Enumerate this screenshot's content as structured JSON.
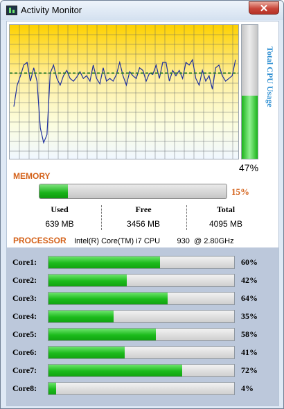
{
  "window": {
    "title": "Activity Monitor",
    "close_glyph": "✕"
  },
  "cpu": {
    "total_label": "Total CPU Usage",
    "total_percent_text": "47%",
    "total_percent": 47,
    "history": [
      39,
      55,
      62,
      70,
      72,
      58,
      68,
      58,
      23,
      12,
      18,
      64,
      70,
      60,
      55,
      62,
      66,
      60,
      58,
      61,
      65,
      60,
      62,
      58,
      70,
      60,
      56,
      68,
      58,
      60,
      58,
      63,
      72,
      62,
      55,
      65,
      62,
      60,
      68,
      66,
      58,
      64,
      63,
      70,
      60,
      72,
      72,
      58,
      66,
      62,
      66,
      60,
      72,
      70,
      74,
      60,
      55,
      66,
      58,
      62,
      52,
      68,
      70,
      62,
      58,
      60,
      62,
      74
    ],
    "average": 64
  },
  "memory": {
    "title": "MEMORY",
    "percent_text": "15%",
    "percent": 15,
    "used_label": "Used",
    "used_value": "639 MB",
    "free_label": "Free",
    "free_value": "3456 MB",
    "total_label": "Total",
    "total_value": "4095 MB"
  },
  "processor": {
    "title": "PROCESSOR",
    "name": "Intel(R) Core(TM) i7 CPU        930  @ 2.80GHz"
  },
  "cores": [
    {
      "label": "Core1:",
      "percent": 60,
      "percent_text": "60%"
    },
    {
      "label": "Core2:",
      "percent": 42,
      "percent_text": "42%"
    },
    {
      "label": "Core3:",
      "percent": 64,
      "percent_text": "64%"
    },
    {
      "label": "Core4:",
      "percent": 35,
      "percent_text": "35%"
    },
    {
      "label": "Core5:",
      "percent": 58,
      "percent_text": "58%"
    },
    {
      "label": "Core6:",
      "percent": 41,
      "percent_text": "41%"
    },
    {
      "label": "Core7:",
      "percent": 72,
      "percent_text": "72%"
    },
    {
      "label": "Core8:",
      "percent": 4,
      "percent_text": "4%"
    }
  ],
  "colors": {
    "accent_orange": "#d4621a",
    "cpu_label_blue": "#2f8fd2",
    "bar_green": "#1cbb1c",
    "graph_line": "#1d2f9e",
    "graph_avg": "#2a7a2a"
  }
}
